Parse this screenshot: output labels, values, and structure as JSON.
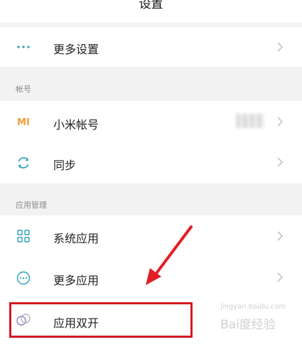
{
  "header": {
    "title": "设置"
  },
  "rows": {
    "more_settings": {
      "label": "更多设置"
    },
    "mi_account": {
      "label": "小米帐号"
    },
    "sync": {
      "label": "同步"
    },
    "system_apps": {
      "label": "系统应用"
    },
    "more_apps": {
      "label": "更多应用"
    },
    "dual_apps": {
      "label": "应用双开"
    }
  },
  "sections": {
    "account": "帐号",
    "app_management": "应用管理"
  },
  "icons": {
    "mi_logo_text": "MI",
    "names": [
      "more-dots-icon",
      "mi-logo-icon",
      "sync-icon",
      "grid-icon",
      "more-circle-icon",
      "dual-circles-icon",
      "chevron-right-icon"
    ]
  },
  "watermark": {
    "main": "Bai度经验",
    "sub": "jingyan.baidu.com"
  },
  "colors": {
    "accent": "#2aa0b8",
    "mi_orange": "#f0a03c",
    "highlight": "#d11a24",
    "arrow": "#e21e26"
  }
}
